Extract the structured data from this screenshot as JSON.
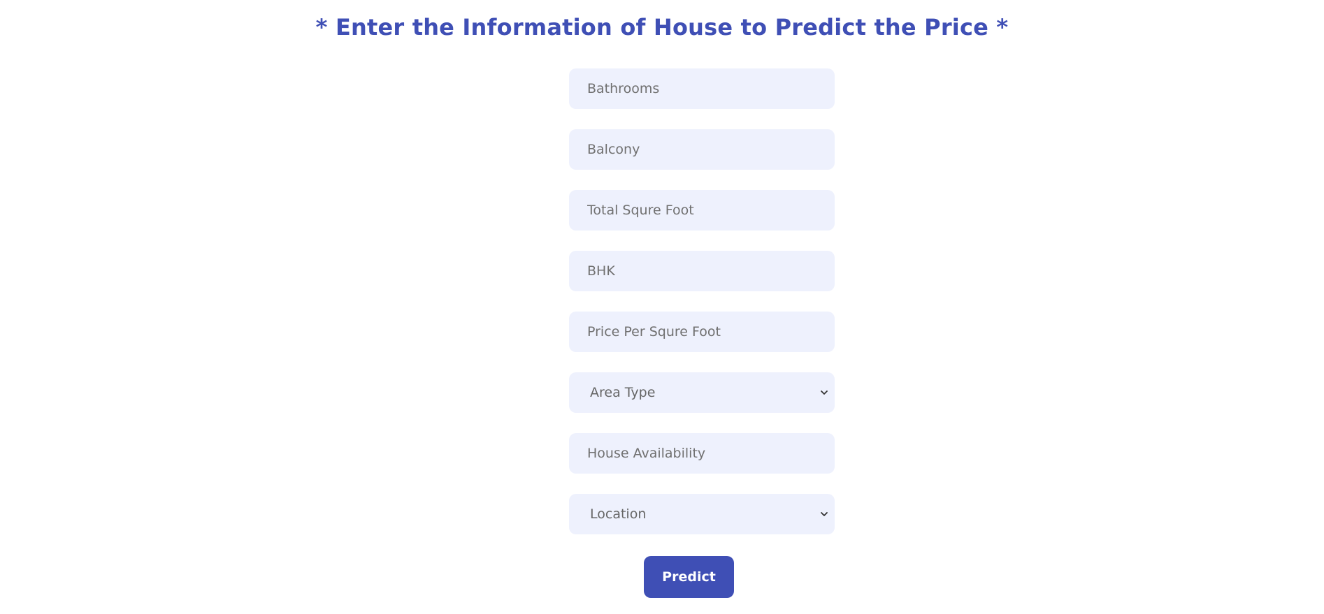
{
  "page": {
    "title": "* Enter the Information of House to Predict the Price *"
  },
  "form": {
    "bathrooms": {
      "placeholder": "Bathrooms",
      "value": ""
    },
    "balcony": {
      "placeholder": "Balcony",
      "value": ""
    },
    "total_sqft": {
      "placeholder": "Total Squre Foot",
      "value": ""
    },
    "bhk": {
      "placeholder": "BHK",
      "value": ""
    },
    "price_per_sqft": {
      "placeholder": "Price Per Squre Foot",
      "value": ""
    },
    "area_type": {
      "selected": "Area Type"
    },
    "availability": {
      "placeholder": "House Availability",
      "value": ""
    },
    "location": {
      "selected": "Location"
    },
    "submit_label": "Predict"
  },
  "icons": {
    "dropdown": "chevron-down-icon"
  },
  "colors": {
    "accent": "#3f4fb5",
    "field_bg": "#eef1fd",
    "placeholder": "#707070"
  }
}
